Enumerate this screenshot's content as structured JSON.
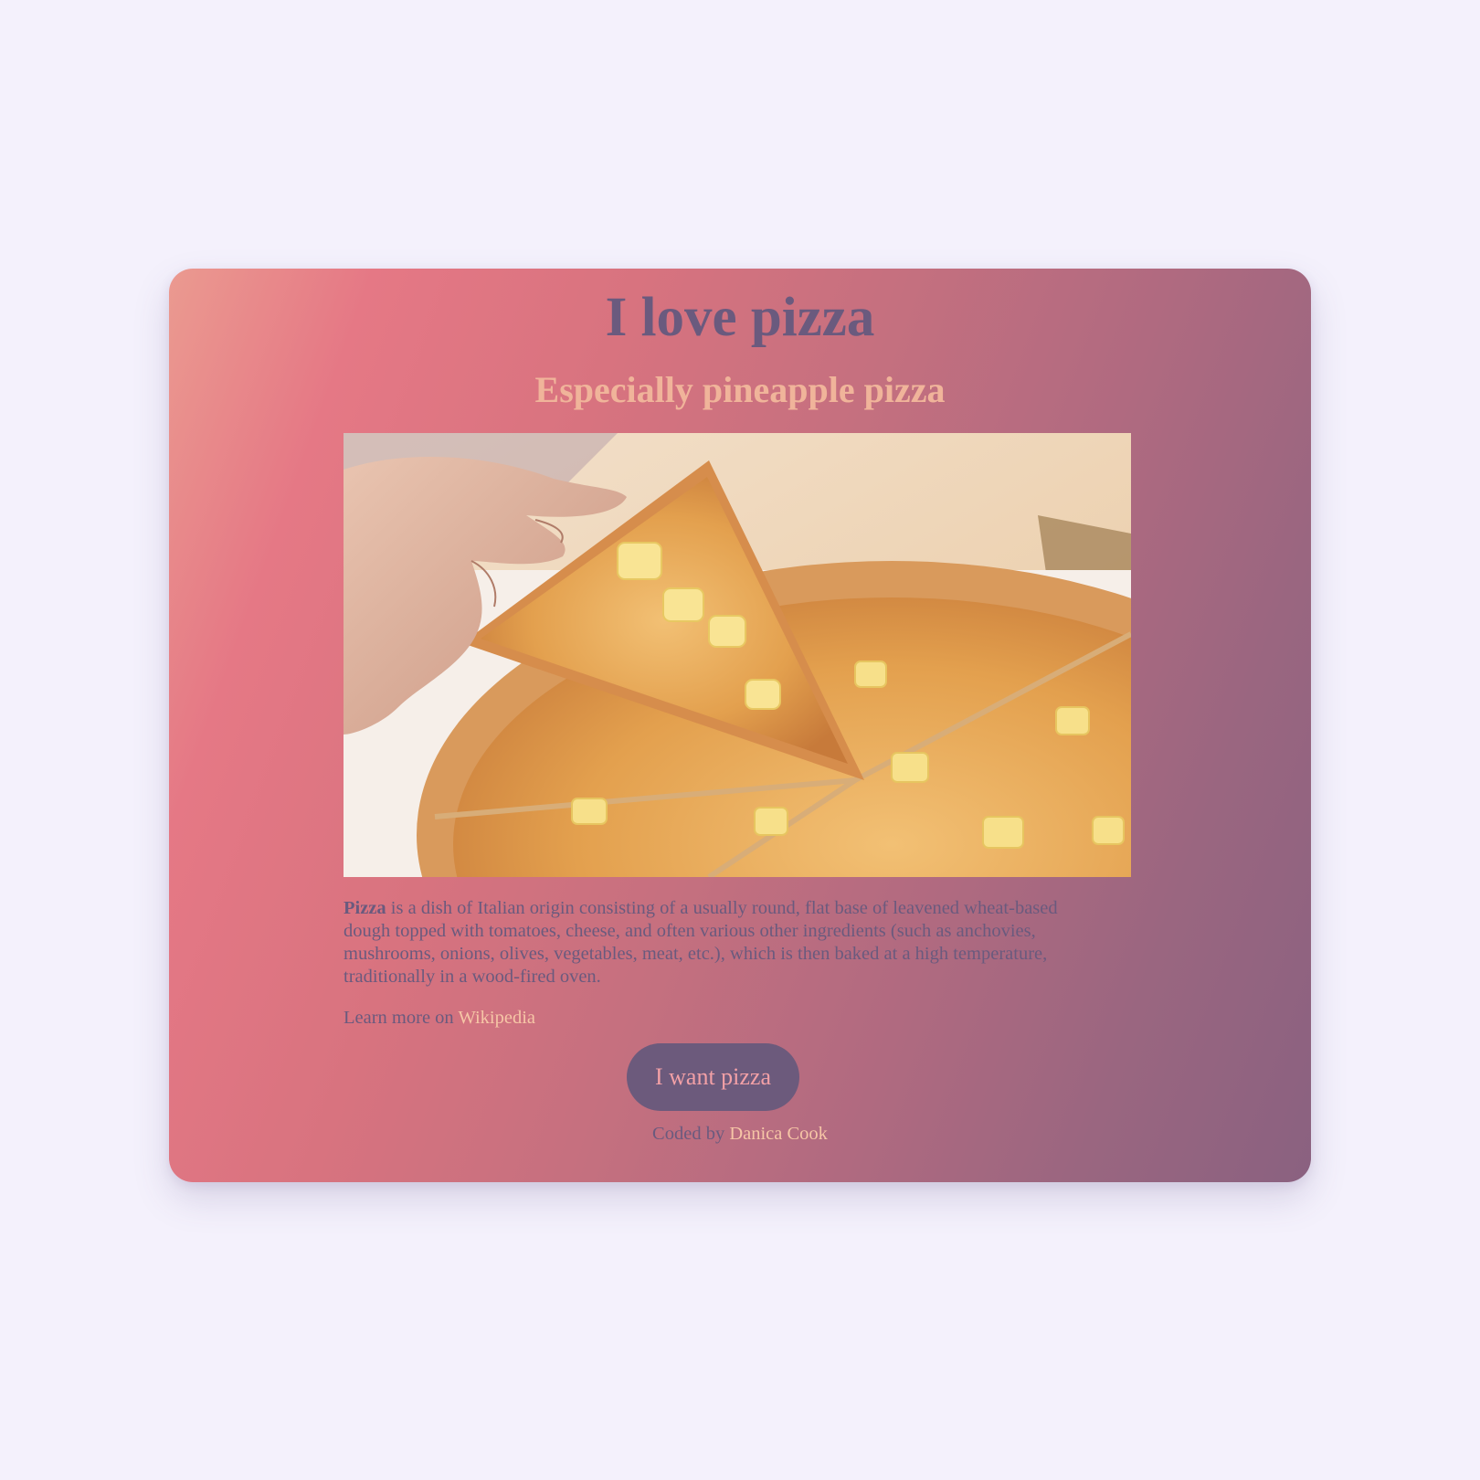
{
  "card": {
    "title": "I love pizza",
    "subtitle": "Especially pineapple pizza",
    "image_alt": "Hand lifting a slice of pineapple pizza from a box",
    "description": {
      "bold_term": "Pizza",
      "text": " is a dish of Italian origin consisting of a usually round, flat base of leavened wheat-based dough topped with tomatoes, cheese, and often various other ingredients (such as anchovies, mushrooms, onions, olives, vegetables, meat, etc.), which is then baked at a high temperature, traditionally in a wood-fired oven."
    },
    "learn_more": {
      "prefix": "Learn more on ",
      "link_label": "Wikipedia"
    },
    "button_label": "I want pizza",
    "credit": {
      "prefix": "Coded by ",
      "author": "Danica Cook"
    }
  },
  "colors": {
    "page_background": "#f4f1fc",
    "gradient_start": "#eb9a90",
    "gradient_end": "#8a6180",
    "title": "#6a5a7e",
    "subtitle": "#f0b49a",
    "link": "#f6c6a6",
    "button_background": "#6c5a7c",
    "button_text": "#f2a0a6"
  }
}
